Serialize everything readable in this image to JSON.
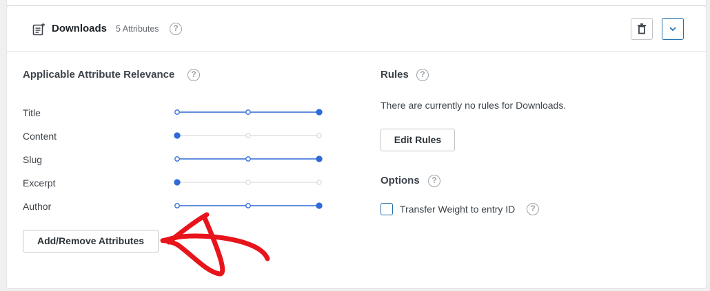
{
  "post_type": {
    "title": "Downloads",
    "attribute_count": "5 Attributes",
    "help_glyph": "?",
    "icon": "post-list-icon",
    "delete_icon": "trash-icon",
    "toggle_icon": "chevron-down-icon"
  },
  "relevance": {
    "title": "Applicable Attribute Relevance",
    "help_glyph": "?",
    "attributes": [
      {
        "label": "Title",
        "level": 3,
        "max": 3
      },
      {
        "label": "Content",
        "level": 1,
        "max": 3
      },
      {
        "label": "Slug",
        "level": 3,
        "max": 3
      },
      {
        "label": "Excerpt",
        "level": 1,
        "max": 3
      },
      {
        "label": "Author",
        "level": 3,
        "max": 3
      }
    ],
    "add_remove_label": "Add/Remove Attributes"
  },
  "rules": {
    "title": "Rules",
    "help_glyph": "?",
    "empty_text": "There are currently no rules for Downloads.",
    "edit_label": "Edit Rules"
  },
  "options": {
    "title": "Options",
    "help_glyph": "?",
    "transfer_weight_label": "Transfer Weight to entry ID",
    "transfer_weight_checked": false,
    "transfer_weight_help_glyph": "?"
  },
  "colors": {
    "accent": "#2f6ad9",
    "inactive": "#dcdcde",
    "annotation": "#e8141c"
  }
}
